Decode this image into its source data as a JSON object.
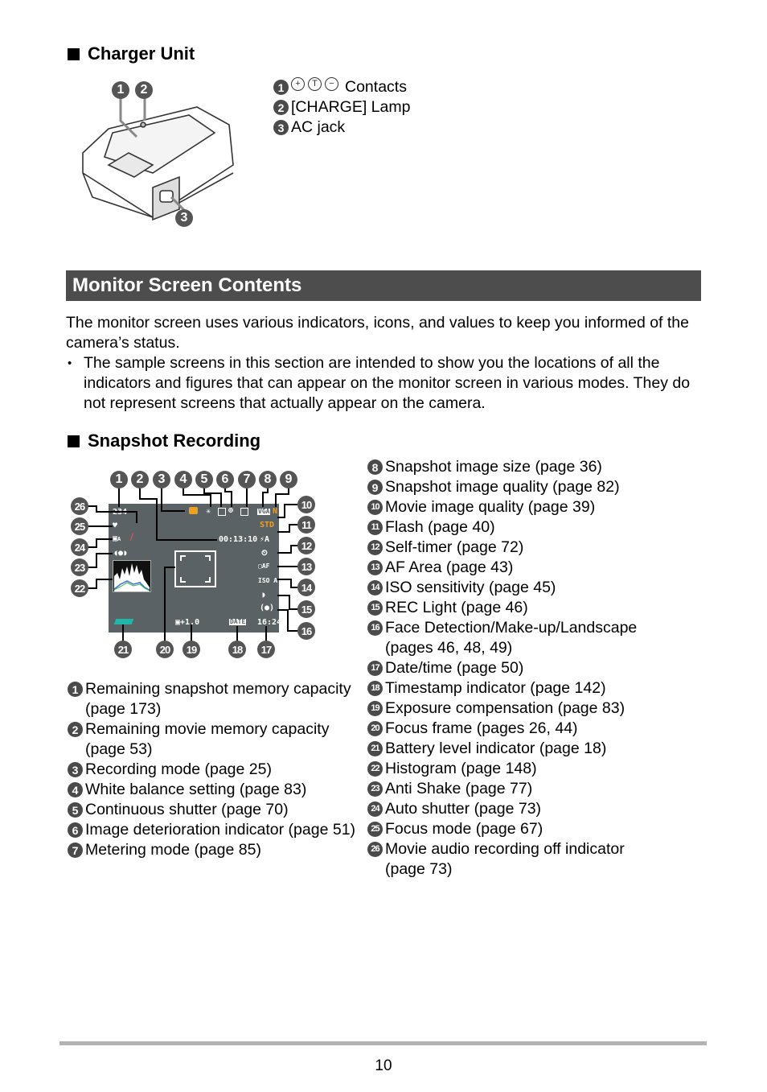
{
  "charger_section": {
    "heading": "Charger Unit",
    "items": [
      {
        "num": "1",
        "symbols": [
          "+",
          "T",
          "−"
        ],
        "label": "Contacts"
      },
      {
        "num": "2",
        "label": "[CHARGE] Lamp"
      },
      {
        "num": "3",
        "label": "AC jack"
      }
    ],
    "diagram_callouts": [
      "1",
      "2",
      "3"
    ]
  },
  "monitor_section": {
    "banner": "Monitor Screen Contents",
    "intro": "The monitor screen uses various indicators, icons, and values to keep you informed of the camera’s status.",
    "bullet_mark": "•",
    "bullet": "The sample screens in this section are intended to show you the locations of all the indicators and figures that can appear on the monitor screen in various modes. They do not represent screens that actually appear on the camera."
  },
  "snapshot_section": {
    "heading": "Snapshot Recording",
    "screen": {
      "remaining_shots": "234",
      "movie_time": "00:13:10",
      "movie_quality": "STD",
      "image_quality": "N",
      "image_size": "VGA",
      "flash": "⚡A",
      "iso": "ISO A",
      "af_area": "AF",
      "exposure": "+1.0",
      "timestamp": "DATE",
      "clock": "16:24",
      "auto_shutter": "A",
      "colors": {
        "screen_bg": "#5b6266",
        "accent_orange": "#f0a020",
        "battery_teal": "#1fb5a8"
      }
    },
    "top_callouts": [
      "1",
      "2",
      "3",
      "4",
      "5",
      "6",
      "7",
      "8",
      "9"
    ],
    "right_callouts": [
      "10",
      "11",
      "12",
      "13",
      "14",
      "15",
      "16"
    ],
    "bottom_callouts": [
      "21",
      "20",
      "19",
      "18",
      "17"
    ],
    "left_callouts": [
      "26",
      "25",
      "24",
      "23",
      "22"
    ],
    "left_list": [
      {
        "num": "1",
        "label": "Remaining snapshot memory capacity (page 173)"
      },
      {
        "num": "2",
        "label": "Remaining movie memory capacity (page 53)"
      },
      {
        "num": "3",
        "label": "Recording mode (page 25)"
      },
      {
        "num": "4",
        "label": "White balance setting (page 83)"
      },
      {
        "num": "5",
        "label": "Continuous shutter (page 70)"
      },
      {
        "num": "6",
        "label": "Image deterioration indicator (page 51)"
      },
      {
        "num": "7",
        "label": "Metering mode (page 85)"
      }
    ],
    "right_list": [
      {
        "num": "8",
        "label": "Snapshot image size (page 36)"
      },
      {
        "num": "9",
        "label": "Snapshot image quality (page 82)"
      },
      {
        "num": "10",
        "label": "Movie image quality (page 39)"
      },
      {
        "num": "11",
        "label": "Flash (page 40)"
      },
      {
        "num": "12",
        "label": "Self-timer (page 72)"
      },
      {
        "num": "13",
        "label": "AF Area (page 43)"
      },
      {
        "num": "14",
        "label": "ISO sensitivity (page 45)"
      },
      {
        "num": "15",
        "label": "REC Light (page 46)"
      },
      {
        "num": "16",
        "label": "Face Detection/Make-up/Landscape (pages 46, 48, 49)"
      },
      {
        "num": "17",
        "label": "Date/time (page 50)"
      },
      {
        "num": "18",
        "label": "Timestamp indicator (page 142)"
      },
      {
        "num": "19",
        "label": "Exposure compensation (page 83)"
      },
      {
        "num": "20",
        "label": "Focus frame (pages 26, 44)"
      },
      {
        "num": "21",
        "label": "Battery level indicator (page 18)"
      },
      {
        "num": "22",
        "label": "Histogram (page 148)"
      },
      {
        "num": "23",
        "label": "Anti Shake (page 77)"
      },
      {
        "num": "24",
        "label": "Auto shutter (page 73)"
      },
      {
        "num": "25",
        "label": "Focus mode (page 67)"
      },
      {
        "num": "26",
        "label": "Movie audio recording off indicator (page 73)"
      }
    ]
  },
  "footer": {
    "page_number": "10"
  }
}
